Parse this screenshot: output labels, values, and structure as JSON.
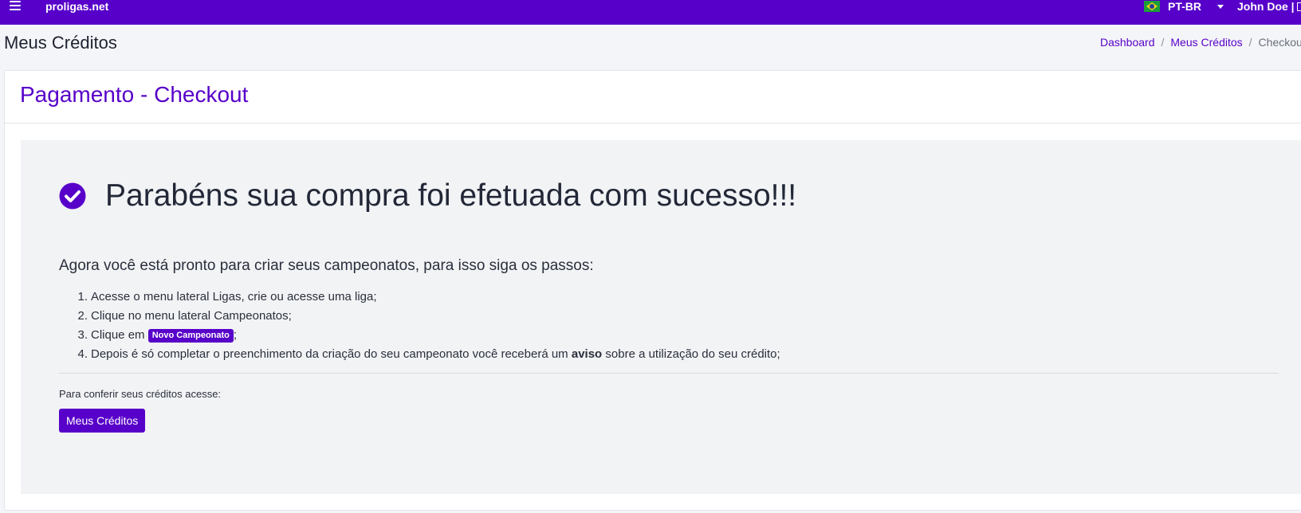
{
  "colors": {
    "brand": "#5700c9",
    "panel_bg": "#f2f3f5",
    "page_bg": "#f4f5f8"
  },
  "topbar": {
    "menu_icon": "hamburger-icon",
    "brand": "proligas.net",
    "language": {
      "flag": "brazil-flag-icon",
      "label": "PT-BR"
    },
    "user": {
      "name": "John Doe |",
      "icon": "user-card-icon"
    }
  },
  "page": {
    "title": "Meus Créditos"
  },
  "breadcrumb": {
    "items": [
      {
        "label": "Dashboard"
      },
      {
        "label": "Meus Créditos"
      },
      {
        "label": "Checkout"
      }
    ],
    "separator": "/"
  },
  "card": {
    "title": "Pagamento - Checkout"
  },
  "success": {
    "icon": "check-circle-icon",
    "title": "Parabéns sua compra foi efetuada com sucesso!!!",
    "intro": "Agora você está pronto para criar seus campeonatos, para isso siga os passos:",
    "steps": [
      {
        "num": "1.",
        "text": "Acesse o menu lateral Ligas, crie ou acesse uma liga;"
      },
      {
        "num": "2.",
        "text": "Clique no menu lateral Campeonatos;"
      },
      {
        "num": "3.",
        "text_before": "Clique em",
        "badge": "Novo Campeonato",
        "text_after": ";"
      },
      {
        "num": "4.",
        "text_before": "Depois é só completar o preenchimento da criação do seu campeonato você receberá um",
        "bold": "aviso",
        "text_after": "sobre a utilização do seu crédito;"
      }
    ],
    "check_credits_text": "Para conferir seus créditos acesse:",
    "button_label": "Meus Créditos"
  }
}
